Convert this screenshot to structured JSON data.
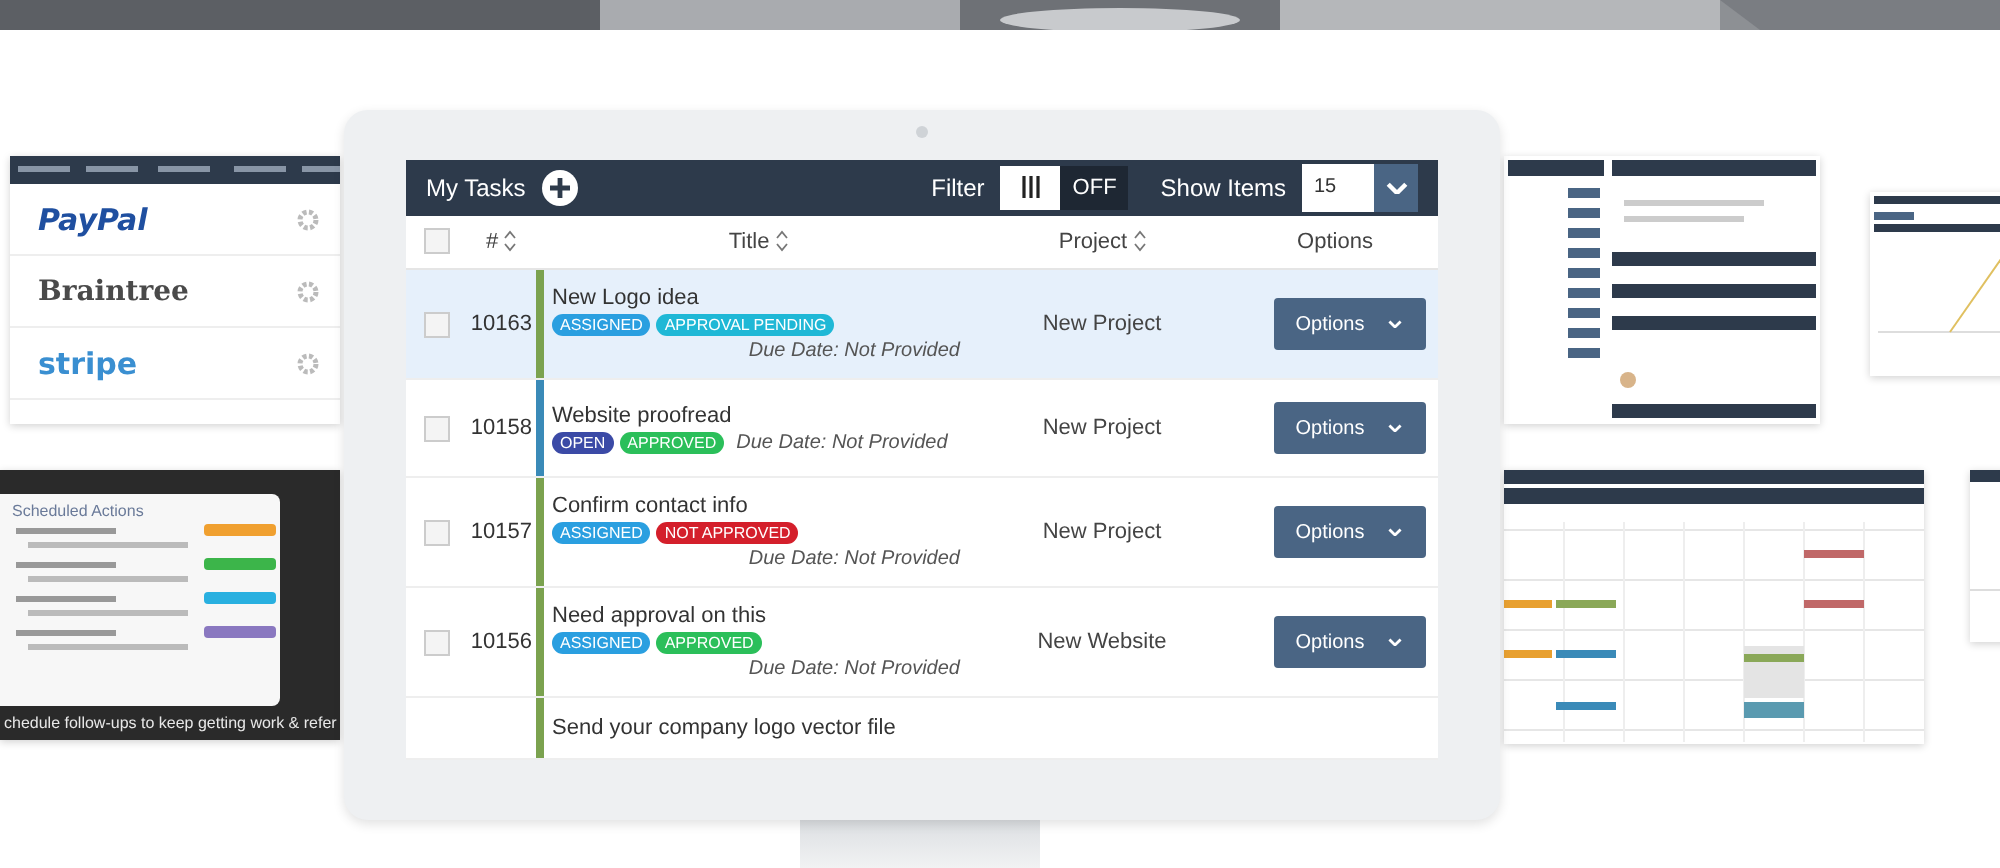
{
  "payments": {
    "providers": [
      {
        "name": "PayPal",
        "kind": "paypal"
      },
      {
        "name": "Braintree",
        "kind": "braintree"
      },
      {
        "name": "stripe",
        "kind": "stripe"
      }
    ]
  },
  "scheduled": {
    "title": "Scheduled Actions",
    "caption": "chedule follow-ups to keep getting work & refer"
  },
  "header": {
    "title": "My Tasks",
    "filter_label": "Filter",
    "filter_on": false,
    "filter_state": "OFF",
    "show_items_label": "Show Items",
    "show_items_value": "15"
  },
  "select_all": {
    "checked": false
  },
  "columns": [
    {
      "label": "#",
      "sortable": true
    },
    {
      "label": "Title",
      "sortable": true
    },
    {
      "label": "Project",
      "sortable": true
    },
    {
      "label": "Options",
      "sortable": false
    }
  ],
  "tasks": [
    {
      "kind": "full",
      "id": "10163",
      "title": "New Logo idea",
      "selected": true,
      "checked": false,
      "color": "#7ba24f",
      "tags": [
        {
          "label": "ASSIGNED",
          "color": "#2a9fe0"
        },
        {
          "label": "APPROVAL PENDING",
          "color": "#1fb8d6"
        }
      ],
      "due": "Due Date: Not Provided",
      "due_inline": false,
      "project": "New Project",
      "action": "Options"
    },
    {
      "kind": "full",
      "id": "10158",
      "title": "Website proofread",
      "selected": false,
      "checked": false,
      "color": "#3a8ab8",
      "tags": [
        {
          "label": "OPEN",
          "color": "#3b4aa6"
        },
        {
          "label": "APPROVED",
          "color": "#2bbf5a"
        }
      ],
      "due": "Due Date: Not Provided",
      "due_inline": true,
      "project": "New Project",
      "action": "Options"
    },
    {
      "kind": "full",
      "id": "10157",
      "title": "Confirm contact info",
      "selected": false,
      "checked": false,
      "color": "#7ba24f",
      "tags": [
        {
          "label": "ASSIGNED",
          "color": "#2a9fe0"
        },
        {
          "label": "NOT APPROVED",
          "color": "#d41f2b"
        }
      ],
      "due": "Due Date: Not Provided",
      "due_inline": false,
      "project": "New Project",
      "action": "Options"
    },
    {
      "kind": "full",
      "id": "10156",
      "title": "Need approval on this",
      "selected": false,
      "checked": false,
      "color": "#7ba24f",
      "tags": [
        {
          "label": "ASSIGNED",
          "color": "#2a9fe0"
        },
        {
          "label": "APPROVED",
          "color": "#2bbf5a"
        }
      ],
      "due": "Due Date: Not Provided",
      "due_inline": false,
      "project": "New Website",
      "action": "Options"
    },
    {
      "kind": "partial",
      "title": "Send your company logo vector file",
      "selected": false,
      "color": "#7ba24f"
    }
  ]
}
